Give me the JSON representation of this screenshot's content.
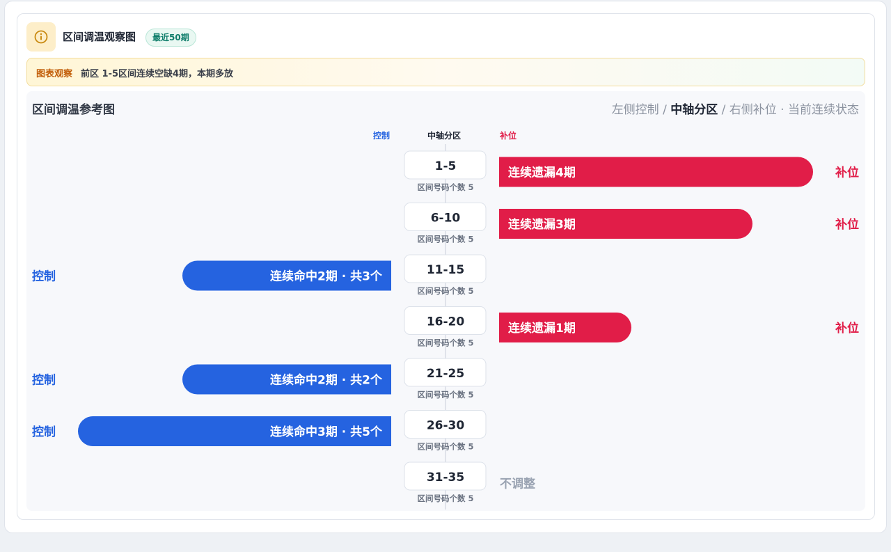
{
  "header": {
    "title": "区间调温观察图",
    "badge": "最近50期"
  },
  "observation": {
    "tag": "图表观察",
    "text": "前区 1-5区间连续空缺4期，本期多放"
  },
  "panel": {
    "title": "区间调温参考图",
    "legend": {
      "left": "左侧控制",
      "sep1": " / ",
      "center": "中轴分区",
      "sep2": " / ",
      "right": "右侧补位",
      "dot": " · ",
      "state": "当前连续状态"
    }
  },
  "columns": {
    "left": "控制",
    "center": "中轴分区",
    "right": "补位"
  },
  "colors": {
    "control": "#2563e0",
    "fill": "#e11d48",
    "neutral": "#9aa3b2"
  },
  "chart_data": {
    "type": "bar",
    "orientation": "diverging-horizontal",
    "categories": [
      "1-5",
      "6-10",
      "11-15",
      "16-20",
      "21-25",
      "26-30",
      "31-35"
    ],
    "sublabels": [
      "区间号码个数 5",
      "区间号码个数 5",
      "区间号码个数 5",
      "区间号码个数 5",
      "区间号码个数 5",
      "区间号码个数 5",
      "区间号码个数 5"
    ],
    "series": [
      {
        "name": "控制",
        "side": "left",
        "values": [
          null,
          null,
          2,
          null,
          2,
          3,
          null
        ],
        "bar_labels": [
          null,
          null,
          "连续命中2期 · 共3个",
          null,
          "连续命中2期 · 共2个",
          "连续命中3期 · 共5个",
          null
        ],
        "side_labels": [
          null,
          null,
          "控制",
          null,
          "控制",
          "控制",
          null
        ]
      },
      {
        "name": "补位",
        "side": "right",
        "values": [
          4,
          3,
          null,
          1,
          null,
          null,
          null
        ],
        "bar_labels": [
          "连续遗漏4期",
          "连续遗漏3期",
          null,
          "连续遗漏1期",
          null,
          null,
          null
        ],
        "side_labels": [
          "补位",
          "补位",
          null,
          "补位",
          null,
          null,
          null
        ]
      }
    ],
    "neutral_labels": [
      null,
      null,
      null,
      null,
      null,
      null,
      "不调整"
    ]
  }
}
